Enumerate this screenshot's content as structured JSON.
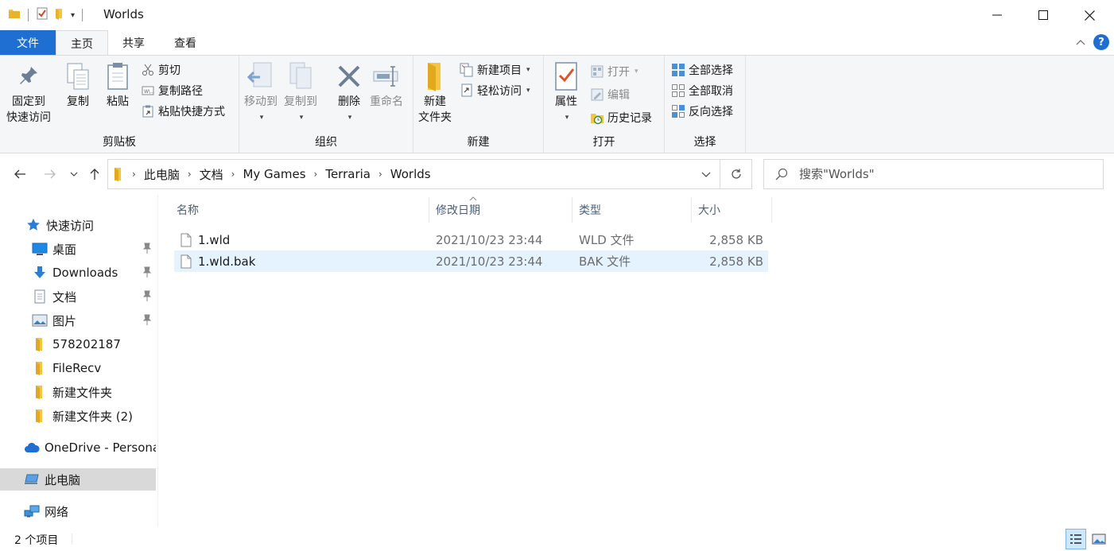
{
  "window": {
    "title": "Worlds",
    "controls": [
      "minimize",
      "maximize",
      "close"
    ]
  },
  "ribbon_tabs": {
    "file": "文件",
    "items": [
      "主页",
      "共享",
      "查看"
    ],
    "active": "主页"
  },
  "ribbon": {
    "clipboard": {
      "label": "剪贴板",
      "pin_line1": "固定到",
      "pin_line2": "快速访问",
      "copy": "复制",
      "paste": "粘贴",
      "cut": "剪切",
      "copy_path": "复制路径",
      "paste_shortcut": "粘贴快捷方式"
    },
    "organize": {
      "label": "组织",
      "move_to": "移动到",
      "copy_to": "复制到",
      "delete": "删除",
      "rename": "重命名"
    },
    "new": {
      "label": "新建",
      "new_folder_line1": "新建",
      "new_folder_line2": "文件夹",
      "new_item": "新建项目",
      "easy_access": "轻松访问"
    },
    "open": {
      "label": "打开",
      "properties": "属性",
      "open": "打开",
      "edit": "编辑",
      "history": "历史记录"
    },
    "select": {
      "label": "选择",
      "select_all": "全部选择",
      "select_none": "全部取消",
      "invert": "反向选择"
    }
  },
  "address": {
    "breadcrumbs": [
      "此电脑",
      "文档",
      "My Games",
      "Terraria",
      "Worlds"
    ],
    "search_placeholder": "搜索\"Worlds\""
  },
  "nav_pane": {
    "quick_access": "快速访问",
    "pinned": [
      {
        "label": "桌面",
        "icon": "desktop-icon"
      },
      {
        "label": "Downloads",
        "icon": "download-icon"
      },
      {
        "label": "文档",
        "icon": "document-icon"
      },
      {
        "label": "图片",
        "icon": "pictures-icon"
      }
    ],
    "folders": [
      "578202187",
      "FileRecv",
      "新建文件夹",
      "新建文件夹 (2)"
    ],
    "onedrive": "OneDrive - Persona",
    "this_pc": "此电脑",
    "network": "网络"
  },
  "file_list": {
    "columns": [
      "名称",
      "修改日期",
      "类型",
      "大小"
    ],
    "rows": [
      {
        "name": "1.wld",
        "modified": "2021/10/23 23:44",
        "type": "WLD 文件",
        "size": "2,858 KB"
      },
      {
        "name": "1.wld.bak",
        "modified": "2021/10/23 23:44",
        "type": "BAK 文件",
        "size": "2,858 KB"
      }
    ],
    "selected_row": 1
  },
  "status_bar": {
    "item_count": "2 个项目"
  },
  "colors": {
    "accent": "#1e6fd1",
    "folder": "#f5c542",
    "selection": "#e5f3ff",
    "nav_selected": "#d9d9d9"
  }
}
